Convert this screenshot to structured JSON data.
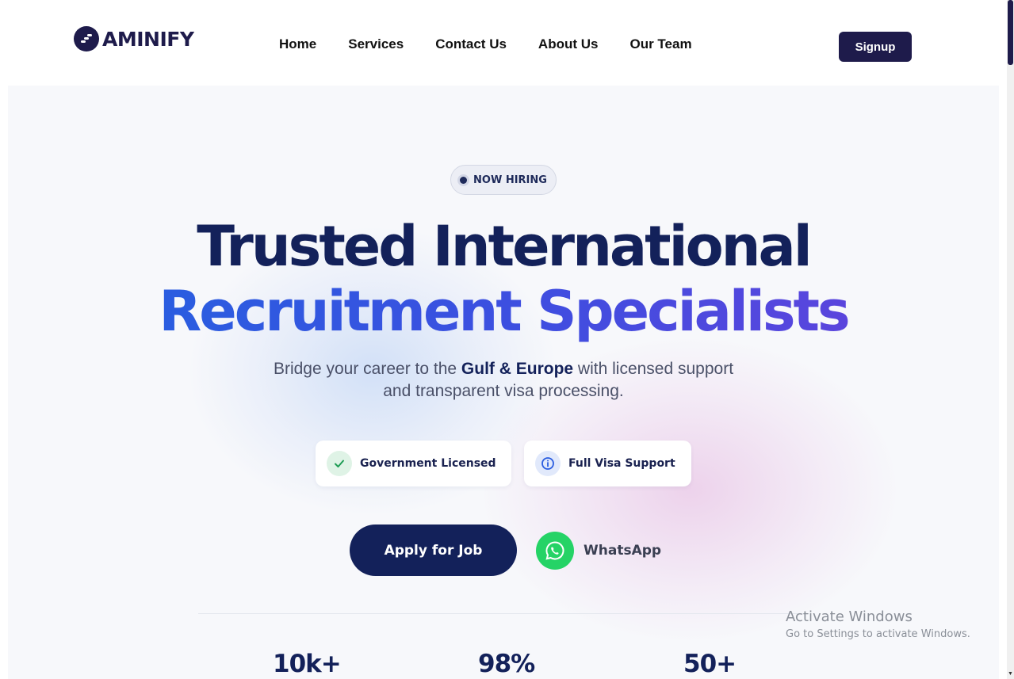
{
  "header": {
    "logo_text": "AMINIFY",
    "nav": [
      "Home",
      "Services",
      "Contact Us",
      "About Us",
      "Our Team"
    ],
    "signup_label": "Signup"
  },
  "hero": {
    "badge": "NOW HIRING",
    "title_line1": "Trusted International",
    "title_line2": "Recruitment Specialists",
    "subtitle_part1": "Bridge your career to the ",
    "subtitle_bold": "Gulf & Europe",
    "subtitle_part2": " with licensed support",
    "subtitle_line2": "and transparent visa processing.",
    "features": [
      {
        "label": "Government Licensed",
        "icon": "check-icon",
        "icon_color": "#1f9d55",
        "icon_bg": "#dff3e6"
      },
      {
        "label": "Full Visa Support",
        "icon": "info-icon",
        "icon_color": "#2a5de0",
        "icon_bg": "#e1e9fb"
      }
    ],
    "apply_label": "Apply for Job",
    "whatsapp_label": "WhatsApp"
  },
  "stats": [
    "10k+",
    "98%",
    "50+"
  ],
  "watermark": {
    "line1": "Activate Windows",
    "line2": "Go to Settings to activate Windows."
  },
  "colors": {
    "brand_navy": "#13215a",
    "logo_navy": "#1e1b4b",
    "gradient_start": "#2a5de0",
    "gradient_end": "#5a45dd",
    "whatsapp_green": "#25d366"
  }
}
